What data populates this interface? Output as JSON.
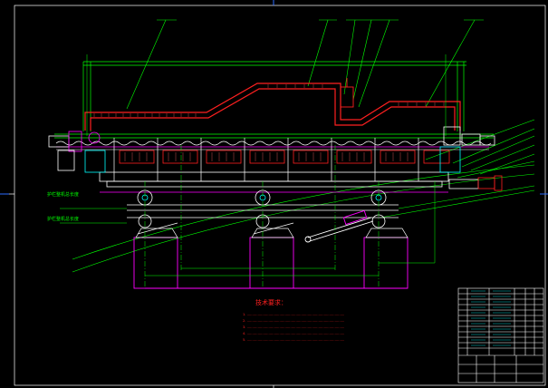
{
  "drawing": {
    "background": "#000000",
    "colors": {
      "frame": "#ffffff",
      "green": "#00ff00",
      "red": "#ff2020",
      "magenta": "#ff00ff",
      "cyan": "#00ffff",
      "yellow": "#ffff00",
      "blue": "#0000ff",
      "white": "#ffffff"
    },
    "side_notes": [
      "护栏整机总长度",
      "护栏整机总长度"
    ],
    "tech_title": "技术要求：",
    "tech_lines": [
      "1. ………………………………………………………………………………",
      "2. ………………………………………………………………………………",
      "3. ………………………………………………………………………………",
      "4. ………………………………………………………………………………",
      "5. ………………………………………………………………………………"
    ]
  }
}
